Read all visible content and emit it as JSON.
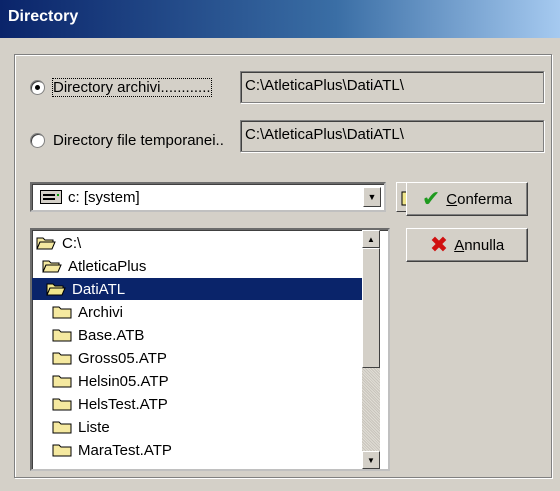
{
  "window": {
    "title": "Directory"
  },
  "options": [
    {
      "label": "Directory archivi............",
      "path": "C:\\AtleticaPlus\\DatiATL\\",
      "checked": true
    },
    {
      "label": "Directory file temporanei..",
      "path": "C:\\AtleticaPlus\\DatiATL\\",
      "checked": false
    }
  ],
  "drive": {
    "label": "c: [system]",
    "icon": "drive-icon"
  },
  "tree": {
    "items": [
      {
        "label": "C:\\",
        "icon": "folder-open-icon",
        "selected": false
      },
      {
        "label": "AtleticaPlus",
        "icon": "folder-open-icon",
        "selected": false
      },
      {
        "label": "DatiATL",
        "icon": "folder-open-icon",
        "selected": true
      },
      {
        "label": "Archivi",
        "icon": "folder-icon",
        "selected": false
      },
      {
        "label": "Base.ATB",
        "icon": "folder-icon",
        "selected": false
      },
      {
        "label": "Gross05.ATP",
        "icon": "folder-icon",
        "selected": false
      },
      {
        "label": "Helsin05.ATP",
        "icon": "folder-icon",
        "selected": false
      },
      {
        "label": "HelsTest.ATP",
        "icon": "folder-icon",
        "selected": false
      },
      {
        "label": "Liste",
        "icon": "folder-icon",
        "selected": false
      },
      {
        "label": "MaraTest.ATP",
        "icon": "folder-icon",
        "selected": false
      }
    ]
  },
  "buttons": {
    "confirm": {
      "accel": "C",
      "rest": "onferma",
      "icon": "checkmark-icon",
      "color": "#1f9a1f"
    },
    "cancel": {
      "accel": "A",
      "rest": "nnulla",
      "icon": "x-icon",
      "color": "#d01010"
    }
  }
}
